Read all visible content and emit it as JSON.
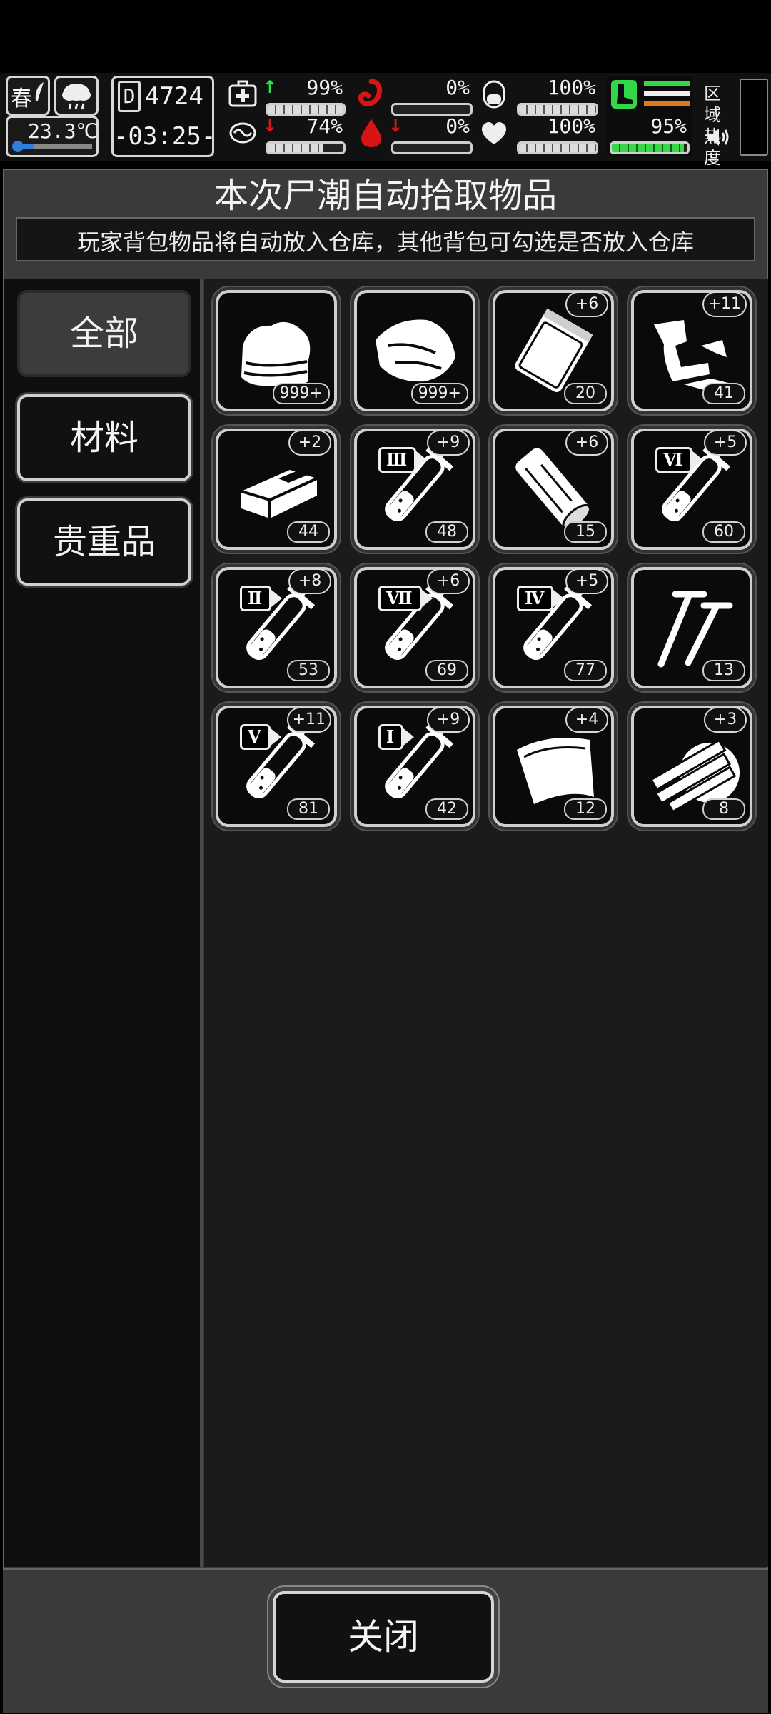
{
  "status": {
    "season": "春",
    "temperature": "23.3℃",
    "day_prefix": "D",
    "day": "4724",
    "time": "-03:25-",
    "health_pct": "99%",
    "hunger_pct": "0%",
    "stamina_pct": "100%",
    "sanity_pct": "74%",
    "bleed_pct": "0%",
    "mood_pct": "100%",
    "leg_pct": "95%",
    "region_heat_label": "区域热度",
    "colors": {
      "up": "#2ee24a",
      "down": "#e01818",
      "red_icon": "#d81414",
      "green_icon": "#32d848",
      "orange": "#e07a1e"
    }
  },
  "dialog": {
    "title": "本次尸潮自动拾取物品",
    "subtitle": "玩家背包物品将自动放入仓库，其他背包可勾选是否放入仓库",
    "tabs": [
      {
        "label": "全部",
        "active": true
      },
      {
        "label": "材料",
        "active": false
      },
      {
        "label": "贵重品",
        "active": false
      }
    ],
    "close_label": "关闭"
  },
  "items": [
    {
      "icon": "cloth-icon",
      "count": "999+",
      "bonus": ""
    },
    {
      "icon": "meat-icon",
      "count": "999+",
      "bonus": ""
    },
    {
      "icon": "plastic-bag-icon",
      "count": "20",
      "bonus": "+6"
    },
    {
      "icon": "rags-icon",
      "count": "41",
      "bonus": "+11"
    },
    {
      "icon": "brick-icon",
      "count": "44",
      "bonus": "+2"
    },
    {
      "icon": "syringe-icon",
      "roman": "Ⅲ",
      "count": "48",
      "bonus": "+9"
    },
    {
      "icon": "wood-log-icon",
      "count": "15",
      "bonus": "+6"
    },
    {
      "icon": "syringe-icon",
      "roman": "Ⅵ",
      "count": "60",
      "bonus": "+5"
    },
    {
      "icon": "syringe-icon",
      "roman": "Ⅱ",
      "count": "53",
      "bonus": "+8"
    },
    {
      "icon": "syringe-icon",
      "roman": "Ⅶ",
      "count": "69",
      "bonus": "+6"
    },
    {
      "icon": "syringe-icon",
      "roman": "Ⅳ",
      "count": "77",
      "bonus": "+5"
    },
    {
      "icon": "nails-icon",
      "count": "13",
      "bonus": ""
    },
    {
      "icon": "syringe-icon",
      "roman": "Ⅴ",
      "count": "81",
      "bonus": "+11"
    },
    {
      "icon": "syringe-icon",
      "roman": "Ⅰ",
      "count": "42",
      "bonus": "+9"
    },
    {
      "icon": "leather-sheet-icon",
      "count": "12",
      "bonus": "+4"
    },
    {
      "icon": "wood-planks-icon",
      "count": "8",
      "bonus": "+3"
    }
  ]
}
